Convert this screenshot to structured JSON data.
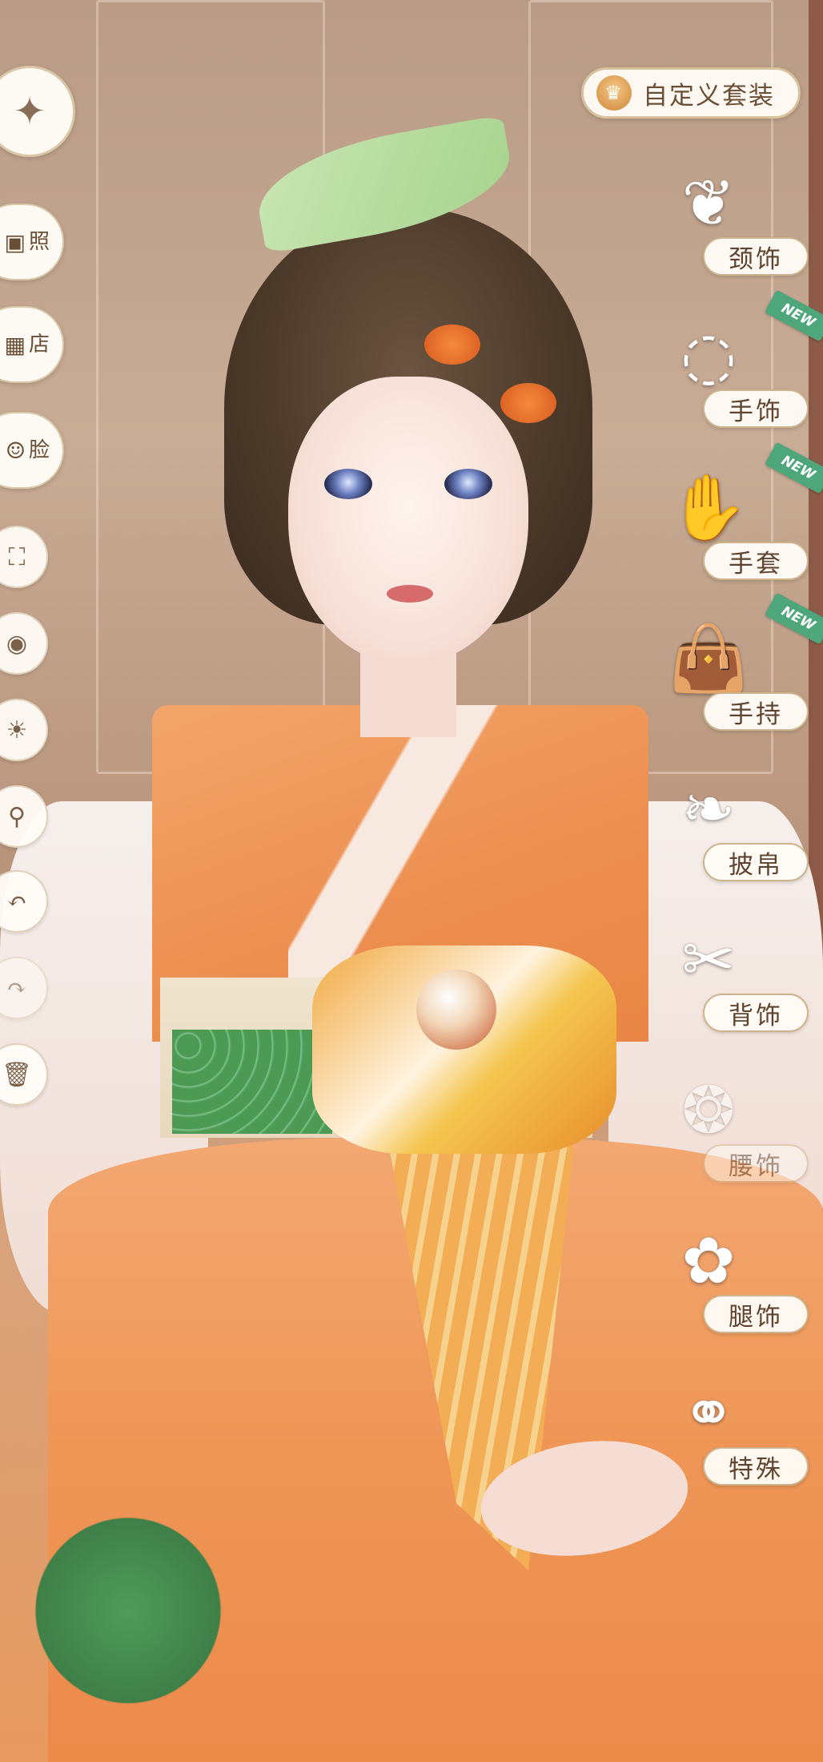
{
  "header": {
    "custom_outfit_label": "自定义套装"
  },
  "left_toolbar": {
    "photo_label": "照",
    "shop_label": "店",
    "face_label": "脸"
  },
  "accessory_menu": [
    {
      "label": "颈饰",
      "icon": "necklace-bow-icon",
      "is_new": false
    },
    {
      "label": "手饰",
      "icon": "bracelet-icon",
      "is_new": true
    },
    {
      "label": "手套",
      "icon": "glove-icon",
      "is_new": true
    },
    {
      "label": "手持",
      "icon": "handbag-icon",
      "is_new": true
    },
    {
      "label": "披帛",
      "icon": "shawl-icon",
      "is_new": false
    },
    {
      "label": "背饰",
      "icon": "back-bow-icon",
      "is_new": false
    },
    {
      "label": "腰饰",
      "icon": "waist-ornament-icon",
      "is_new": false
    },
    {
      "label": "腿饰",
      "icon": "leg-ornament-icon",
      "is_new": false
    },
    {
      "label": "特殊",
      "icon": "special-ring-icon",
      "is_new": false
    }
  ],
  "new_badge_text": "NEW",
  "colors": {
    "accent_gold": "#d8c29c",
    "label_text": "#5e4430",
    "new_badge": "#4ea77a"
  }
}
